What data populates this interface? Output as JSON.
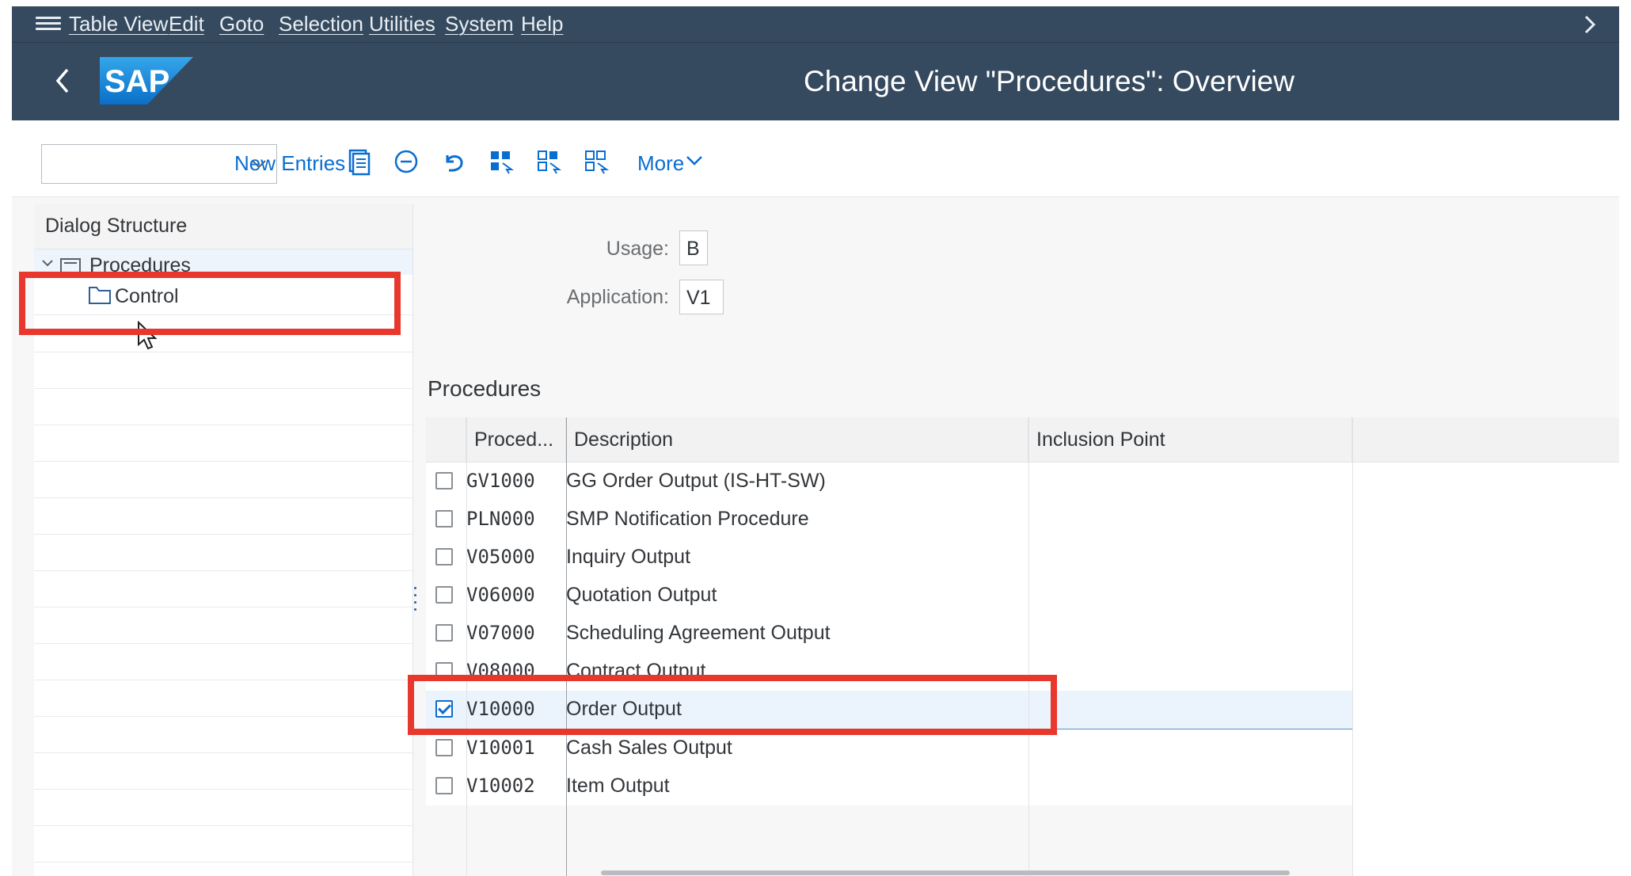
{
  "menu": {
    "items": [
      "Table View",
      "Edit",
      "Goto",
      "Selection",
      "Utilities",
      "System",
      "Help"
    ]
  },
  "shell": {
    "logo_text": "SAP",
    "title": "Change View \"Procedures\": Overview"
  },
  "toolbar": {
    "combo_value": "",
    "new_entries": "New Entries",
    "more": "More"
  },
  "dialog_structure": {
    "header": "Dialog Structure",
    "procedures": "Procedures",
    "control": "Control"
  },
  "fields": {
    "usage_label": "Usage:",
    "usage_value": "B",
    "application_label": "Application:",
    "application_value": "V1"
  },
  "table": {
    "section_title": "Procedures",
    "columns": [
      "Proced...",
      "Description",
      "Inclusion Point"
    ],
    "rows": [
      {
        "code": "GV1000",
        "description": "GG Order Output (IS-HT-SW)",
        "checked": false
      },
      {
        "code": "PLN000",
        "description": "SMP Notification Procedure",
        "checked": false
      },
      {
        "code": "V05000",
        "description": "Inquiry Output",
        "checked": false
      },
      {
        "code": "V06000",
        "description": "Quotation Output",
        "checked": false
      },
      {
        "code": "V07000",
        "description": "Scheduling Agreement Output",
        "checked": false
      },
      {
        "code": "V08000",
        "description": "Contract Output",
        "checked": false
      },
      {
        "code": "V10000",
        "description": "Order Output",
        "checked": true
      },
      {
        "code": "V10001",
        "description": "Cash Sales Output",
        "checked": false
      },
      {
        "code": "V10002",
        "description": "Item Output",
        "checked": false
      }
    ]
  },
  "colors": {
    "shell": "#354a5f",
    "accent": "#0a6ed1",
    "highlight": "#e8372c"
  }
}
